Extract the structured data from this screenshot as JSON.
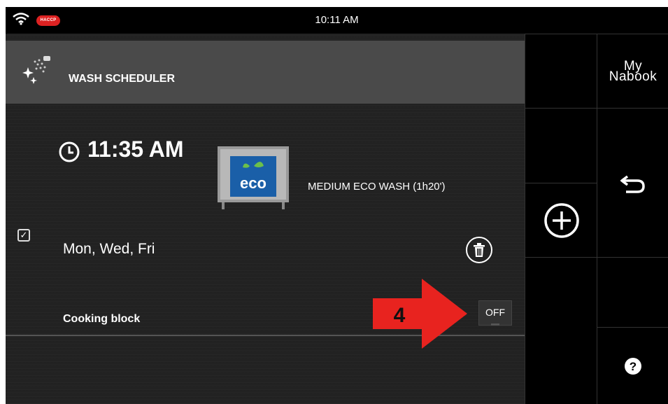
{
  "status_bar": {
    "time": "10:11 AM",
    "haccp_badge": "HACCP",
    "wifi_icon": "wifi-icon"
  },
  "header": {
    "title": "WASH SCHEDULER",
    "icon": "wash-sparkle-icon"
  },
  "schedule": {
    "time": "11:35 AM",
    "program_icon": "eco-wash-icon",
    "program_icon_text": "eco",
    "program": "MEDIUM ECO WASH (1h20')",
    "enabled": true,
    "days": "Mon, Wed, Fri",
    "cooking_block_label": "Cooking block",
    "cooking_block_state": "OFF"
  },
  "right_panel": {
    "mynabook_line1": "My",
    "mynabook_line2": "Nabook",
    "add_icon": "plus-circle-icon",
    "back_icon": "undo-arrow-icon",
    "help_icon": "question-icon"
  },
  "annotation": {
    "step_number": "4",
    "color": "#e8231f"
  }
}
